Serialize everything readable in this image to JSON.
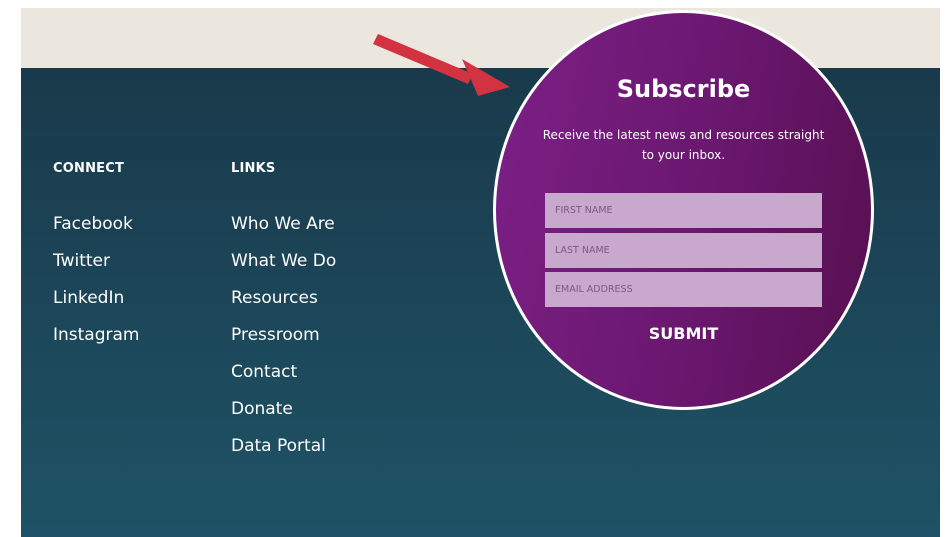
{
  "connect": {
    "heading": "CONNECT",
    "items": [
      {
        "label": "Facebook"
      },
      {
        "label": "Twitter"
      },
      {
        "label": "LinkedIn"
      },
      {
        "label": "Instagram"
      }
    ]
  },
  "links": {
    "heading": "LINKS",
    "items": [
      {
        "label": "Who We Are"
      },
      {
        "label": "What We Do"
      },
      {
        "label": "Resources"
      },
      {
        "label": "Pressroom"
      },
      {
        "label": "Contact"
      },
      {
        "label": "Donate"
      },
      {
        "label": "Data Portal"
      }
    ]
  },
  "subscribe": {
    "title": "Subscribe",
    "description": "Receive the latest news and resources straight to your inbox.",
    "first_name_placeholder": "FIRST NAME",
    "last_name_placeholder": "LAST NAME",
    "email_placeholder": "EMAIL ADDRESS",
    "submit_label": "SUBMIT"
  },
  "colors": {
    "top_band": "#ebe6de",
    "footer_top": "#193a4b",
    "footer_bottom": "#1f5266",
    "circle_purple": "#6a176f",
    "field_bg": "#c8a8cc",
    "arrow_red": "#d33240"
  },
  "icons": {
    "annotation": "red-arrow-icon"
  }
}
